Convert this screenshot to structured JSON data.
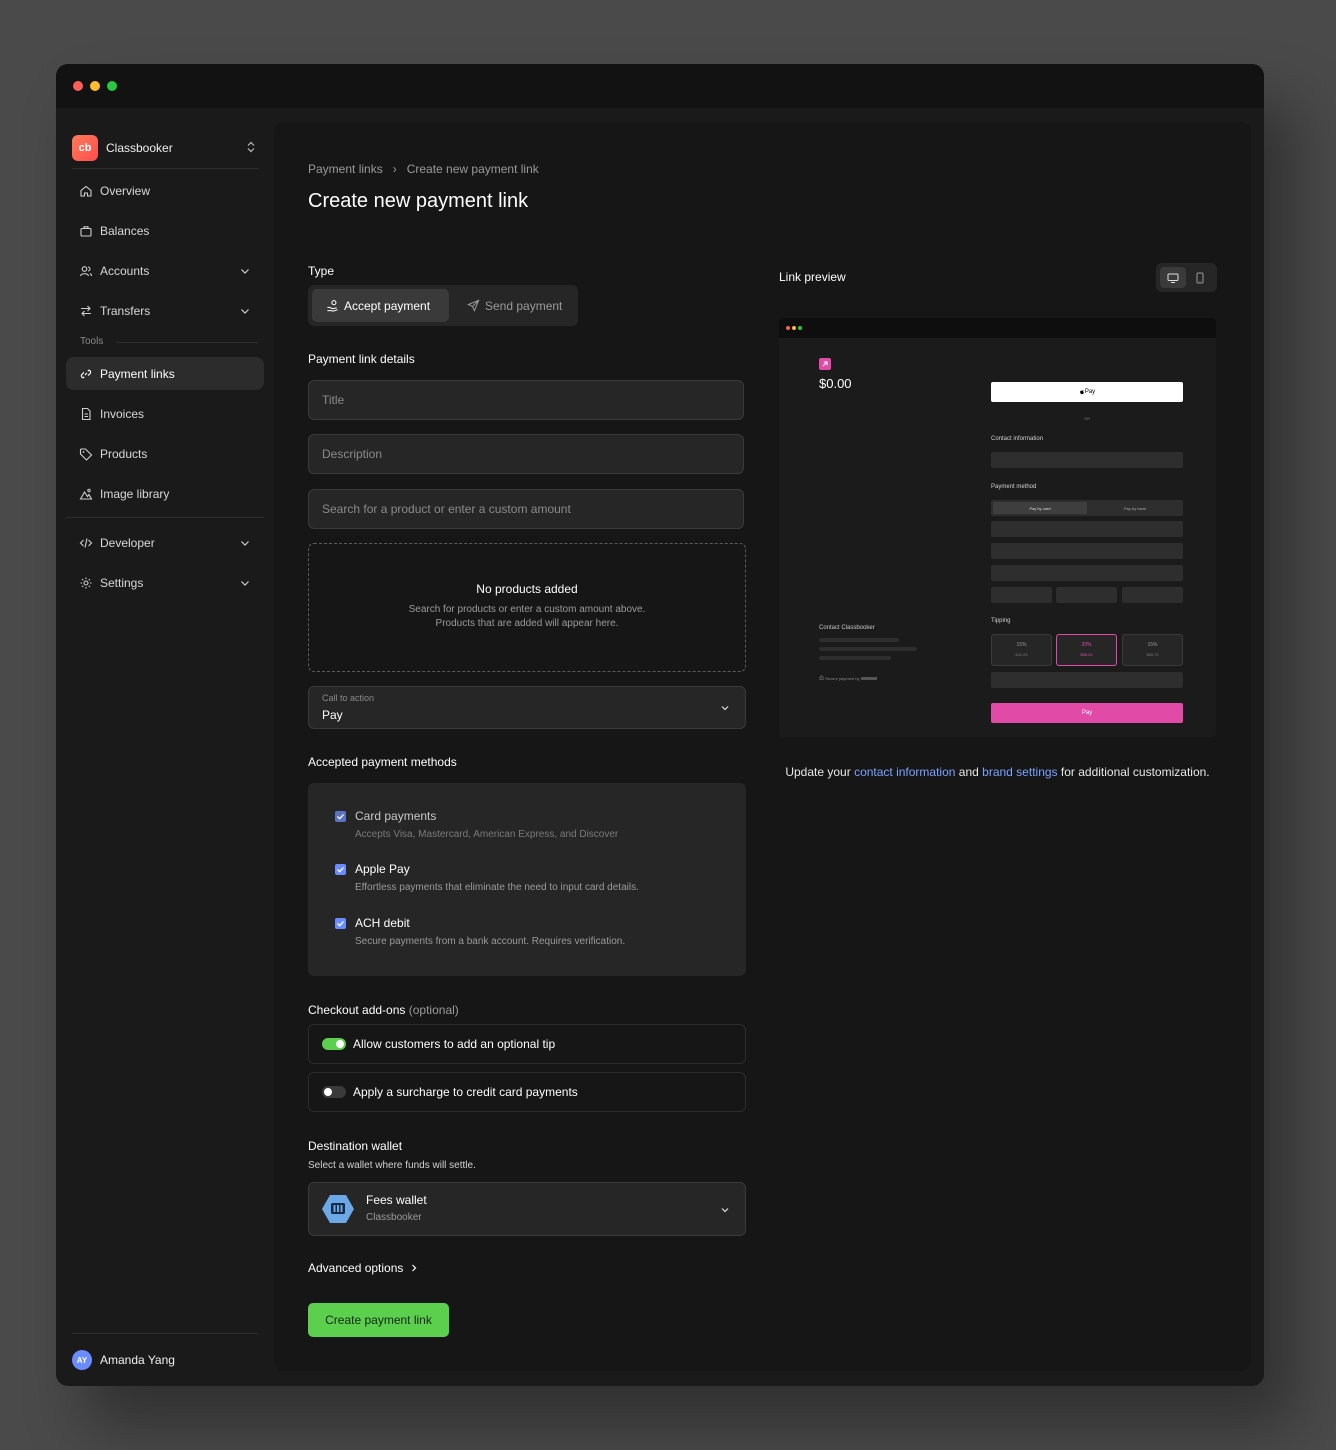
{
  "window": {
    "dots": [
      "close",
      "minimize",
      "maximize"
    ]
  },
  "sidebar": {
    "brand": {
      "logo": "cb",
      "name": "Classbooker"
    },
    "items": [
      {
        "label": "Overview",
        "icon": "home-icon"
      },
      {
        "label": "Balances",
        "icon": "briefcase-icon"
      },
      {
        "label": "Accounts",
        "icon": "users-icon",
        "expandable": true
      },
      {
        "label": "Transfers",
        "icon": "arrows-icon",
        "expandable": true
      }
    ],
    "tools_label": "Tools",
    "tools": [
      {
        "label": "Payment links",
        "icon": "link-icon",
        "active": true
      },
      {
        "label": "Invoices",
        "icon": "document-icon"
      },
      {
        "label": "Products",
        "icon": "tag-icon"
      },
      {
        "label": "Image library",
        "icon": "image-icon"
      }
    ],
    "bottom_items": [
      {
        "label": "Developer",
        "icon": "code-icon",
        "expandable": true
      },
      {
        "label": "Settings",
        "icon": "gear-icon",
        "expandable": true
      }
    ],
    "user": {
      "initials": "AY",
      "name": "Amanda Yang"
    }
  },
  "breadcrumb": {
    "parent": "Payment links",
    "separator": "›",
    "current": "Create new payment link"
  },
  "page_title": "Create new payment link",
  "type": {
    "label": "Type",
    "options": [
      {
        "label": "Accept payment",
        "selected": true
      },
      {
        "label": "Send payment",
        "selected": false
      }
    ]
  },
  "details": {
    "label": "Payment link details",
    "title_placeholder": "Title",
    "description_placeholder": "Description",
    "search_placeholder": "Search for a product or enter a custom amount",
    "empty_title": "No products added",
    "empty_line1": "Search for products or enter a custom amount above.",
    "empty_line2": "Products that are added will appear here.",
    "cta_label": "Call to action",
    "cta_value": "Pay"
  },
  "methods": {
    "label": "Accepted payment methods",
    "items": [
      {
        "title": "Card payments",
        "desc": "Accepts Visa, Mastercard, American Express, and Discover",
        "checked": true
      },
      {
        "title": "Apple Pay",
        "desc": "Effortless payments that eliminate the need to input card details.",
        "checked": true
      },
      {
        "title": "ACH debit",
        "desc": "Secure payments from a bank account. Requires verification.",
        "checked": true
      }
    ]
  },
  "addons": {
    "label": "Checkout add-ons",
    "optional": "(optional)",
    "tip": {
      "label": "Allow customers to add an optional tip",
      "on": true
    },
    "surcharge": {
      "label": "Apply a surcharge to credit card payments",
      "on": false
    }
  },
  "wallet": {
    "label": "Destination wallet",
    "sub": "Select a wallet where funds will settle.",
    "name": "Fees wallet",
    "org": "Classbooker"
  },
  "advanced": "Advanced options",
  "create_button": "Create payment link",
  "preview": {
    "label": "Link preview",
    "amount": "$0.00",
    "apple_pay": " Pay",
    "or": "OR",
    "contact_info": "Contact information",
    "payment_method": "Payment method",
    "pay_by_card": "Pay by card",
    "pay_by_bank": "Pay by bank",
    "tipping": "Tipping",
    "tips": [
      {
        "pct": "15%",
        "amount": "$41.25"
      },
      {
        "pct": "20%",
        "amount": "$55.00",
        "selected": true
      },
      {
        "pct": "15%",
        "amount": "$68.75"
      }
    ],
    "pay": "Pay",
    "contact_merchant": "Contact Classbooker",
    "secure": "Secure payment by",
    "note_pre": "Update your ",
    "note_link1": "contact information",
    "note_mid": " and ",
    "note_link2": "brand settings",
    "note_post": " for additional customization."
  },
  "colors": {
    "accent_green": "#5ccf4f",
    "checkbox_blue": "#6b8cff",
    "preview_pink": "#e24aa8",
    "link_blue": "#7aa2ff"
  }
}
